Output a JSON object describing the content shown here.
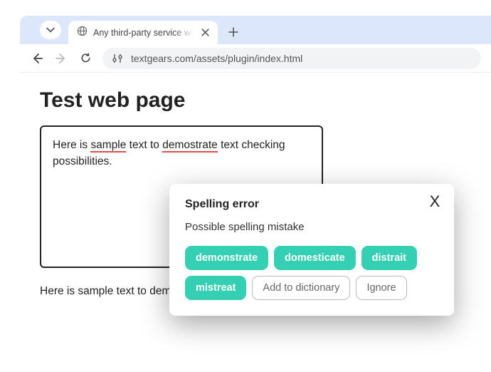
{
  "browser": {
    "tab_title": "Any third-party service web page",
    "url": "textgears.com/assets/plugin/index.html"
  },
  "page": {
    "heading": "Test web page",
    "editor_text_prefix": "Here is ",
    "editor_err1": "sample",
    "editor_text_mid1": " text to ",
    "editor_err2": "demostrate",
    "editor_text_mid2": " text checking possibilities.",
    "below_text": "Here is sample text to demostrate text checking possibilities."
  },
  "popup": {
    "title": "Spelling error",
    "description": "Possible spelling mistake",
    "suggestions": [
      "demonstrate",
      "domesticate",
      "distrait",
      "mistreat"
    ],
    "add_to_dict": "Add to dictionary",
    "ignore": "Ignore",
    "close": "X"
  }
}
